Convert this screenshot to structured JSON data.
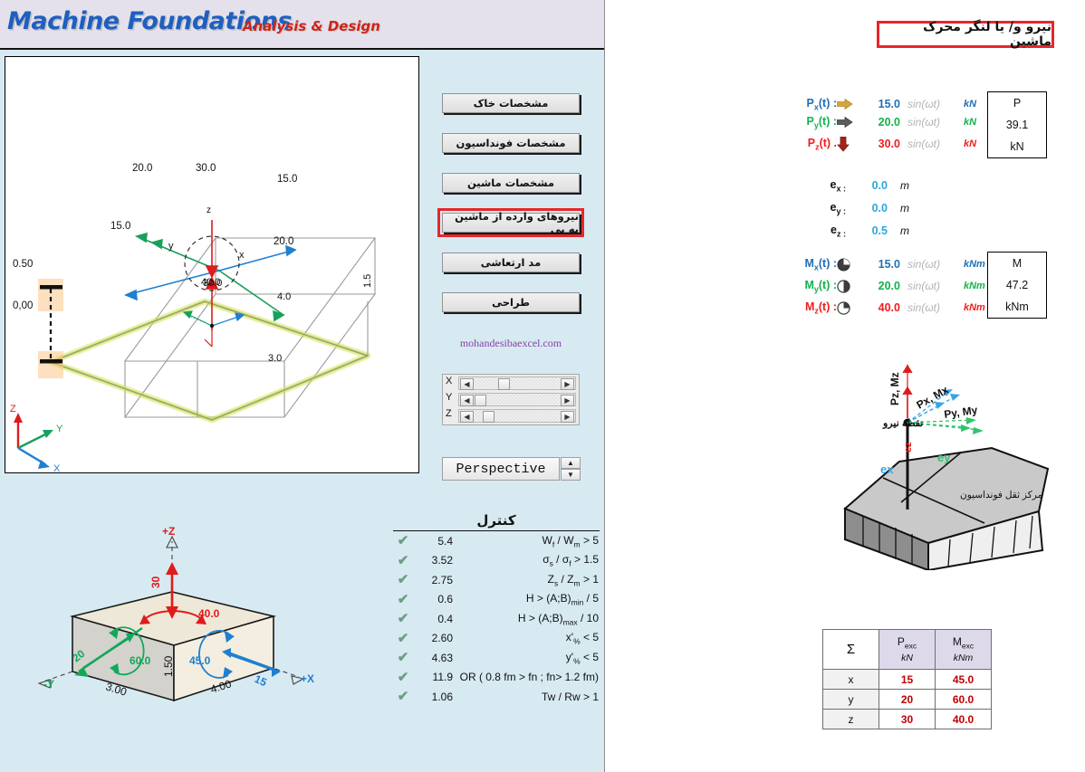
{
  "header": {
    "title_main": "Machine Foundations",
    "title_sub": "Analysis & Design"
  },
  "nav_buttons": [
    {
      "label": "مشخصات خاک",
      "name": "soil-properties",
      "selected": false
    },
    {
      "label": "مشخصات فونداسیون",
      "name": "foundation-properties",
      "selected": false
    },
    {
      "label": "مشخصات ماشین",
      "name": "machine-properties",
      "selected": false
    },
    {
      "label": "نیروهای وارده از ماشین به پی",
      "name": "machine-forces-on-foundation",
      "selected": true
    },
    {
      "label": "مد ارتعاشی",
      "name": "vibration-mode",
      "selected": false
    },
    {
      "label": "طراحی",
      "name": "design",
      "selected": false
    }
  ],
  "weblink": "mohandesibaexcel.com",
  "view_controls": {
    "axes": [
      "X",
      "Y",
      "Z"
    ],
    "left_arrow": "◀",
    "right_arrow": "▶",
    "projection": "Perspective",
    "spin_up": "▲",
    "spin_down": "▼"
  },
  "canvas3d": {
    "labels": {
      "top_left_20": "20.0",
      "top_mid_30": "30.0",
      "top_right_15": "15.0",
      "mid_left_15": "15.0",
      "mid_right_20": "20.0",
      "center_40": "40.0",
      "center_z": "z",
      "axis_y": "y",
      "axis_x": "x",
      "elev_top": "0.50",
      "elev_bottom": "0,00",
      "depth_right": "1.5",
      "edge_4": "4.0",
      "edge_3": "3.0",
      "triad_z": "Z",
      "triad_y": "Y",
      "triad_x": "X"
    }
  },
  "block_diagram": {
    "axis_pz": "+Z",
    "axis_px": "+X",
    "axis_my": "-Y",
    "force_z": "30",
    "moment_z": "40.0",
    "force_y": "20",
    "moment_y": "60.0",
    "force_x": "15",
    "moment_x": "45.0",
    "dim_height": "1.50",
    "dim_width": "3.00",
    "dim_length": "4.00"
  },
  "control": {
    "title": "کنترل",
    "rows": [
      {
        "check": "✔",
        "value": "5.4",
        "formula": "W<sub>f</sub> / W<sub>m</sub> > 5"
      },
      {
        "check": "✔",
        "value": "3.52",
        "formula": "σ<sub>s</sub> / σ<sub>f</sub> > 1.5"
      },
      {
        "check": "✔",
        "value": "2.75",
        "formula": "Z<sub>s</sub> / Z<sub>m</sub> > 1"
      },
      {
        "check": "✔",
        "value": "0.6",
        "formula": "H > (A;B)<sub>min</sub>  / 5"
      },
      {
        "check": "✔",
        "value": "0.4",
        "formula": "H > (A;B)<sub>max</sub> / 10"
      },
      {
        "check": "✔",
        "value": "2.60",
        "formula": "x'<sub>%</sub> < 5"
      },
      {
        "check": "✔",
        "value": "4.63",
        "formula": "y'<sub>%</sub> < 5"
      },
      {
        "check": "✔",
        "value": "11.9",
        "formula": "OR ( 0.8 fm > fn ;  fn> 1.2 fm)"
      },
      {
        "check": "✔",
        "value": "1.06",
        "formula": "Tw / Rw > 1"
      }
    ]
  },
  "forces_panel": {
    "title": "نیرو و/ یا لنگر محرک ماشین",
    "forces": [
      {
        "label": "P<sub>x</sub>(t) :",
        "icon": "arrow-right-gold",
        "value": "15.0",
        "sin": "sin(ωt)",
        "unit": "kN",
        "color": "#1f6fb5"
      },
      {
        "label": "P<sub>y</sub>(t) :",
        "icon": "arrow-right-gray",
        "value": "20.0",
        "sin": "sin(ωt)",
        "unit": "kN",
        "color": "#12b24a"
      },
      {
        "label": "P<sub>z</sub>(t) .",
        "icon": "arrow-down-red",
        "value": "30.0",
        "sin": "sin(ωt)",
        "unit": "kN",
        "color": "#ef1d1d"
      }
    ],
    "eccentricities": [
      {
        "label": "e<sub>x :</sub>",
        "value": "0.0",
        "unit": "m"
      },
      {
        "label": "e<sub>y :</sub>",
        "value": "0.0",
        "unit": "m"
      },
      {
        "label": "e<sub>z :</sub>",
        "value": "0.5",
        "unit": "m"
      }
    ],
    "moments": [
      {
        "label": "M<sub>x</sub>(t) :",
        "icon": "pie-three-quarter",
        "value": "15.0",
        "sin": "sin(ωt)",
        "unit": "kNm",
        "color": "#1f6fb5"
      },
      {
        "label": "M<sub>y</sub>(t) :",
        "icon": "pie-half",
        "value": "20.0",
        "sin": "sin(ωt)",
        "unit": "kNm",
        "color": "#12b24a"
      },
      {
        "label": "M<sub>z</sub>(t) :",
        "icon": "pie-quarter",
        "value": "40.0",
        "sin": "sin(ωt)",
        "unit": "kNm",
        "color": "#ef1d1d"
      }
    ],
    "result_p": {
      "title": "P",
      "value": "39.1",
      "unit": "kN"
    },
    "result_m": {
      "title": "M",
      "value": "47.2",
      "unit": "kNm"
    }
  },
  "foundation_figure": {
    "label_pz": "Pz, Mz",
    "label_px": "Px, Mx",
    "label_py": "Py, My",
    "label_force_point": "نقطه نیرو",
    "label_cog": "مرکز ثقل فونداسیون",
    "label_ex": "ex",
    "label_ey": "ey",
    "label_ez": "ez"
  },
  "summary_table": {
    "sigma": "Σ",
    "columns": [
      {
        "name": "P<sub>exc</sub>",
        "unit": "kN"
      },
      {
        "name": "M<sub>exc</sub>",
        "unit": "kNm"
      }
    ],
    "rows": [
      {
        "axis": "x",
        "p": "15",
        "m": "45.0"
      },
      {
        "axis": "y",
        "p": "20",
        "m": "60.0"
      },
      {
        "axis": "z",
        "p": "30",
        "m": "40.0"
      }
    ]
  },
  "colors": {
    "left_bg": "#d7eaf2",
    "header_bg": "#e4e1ec",
    "brand_blue": "#1f5fbf",
    "brand_red": "#cf2418",
    "accent_red": "#e8262a",
    "check_green": "#6e9c86",
    "table_header": "#ddd9ea",
    "data_red": "#c00000"
  }
}
